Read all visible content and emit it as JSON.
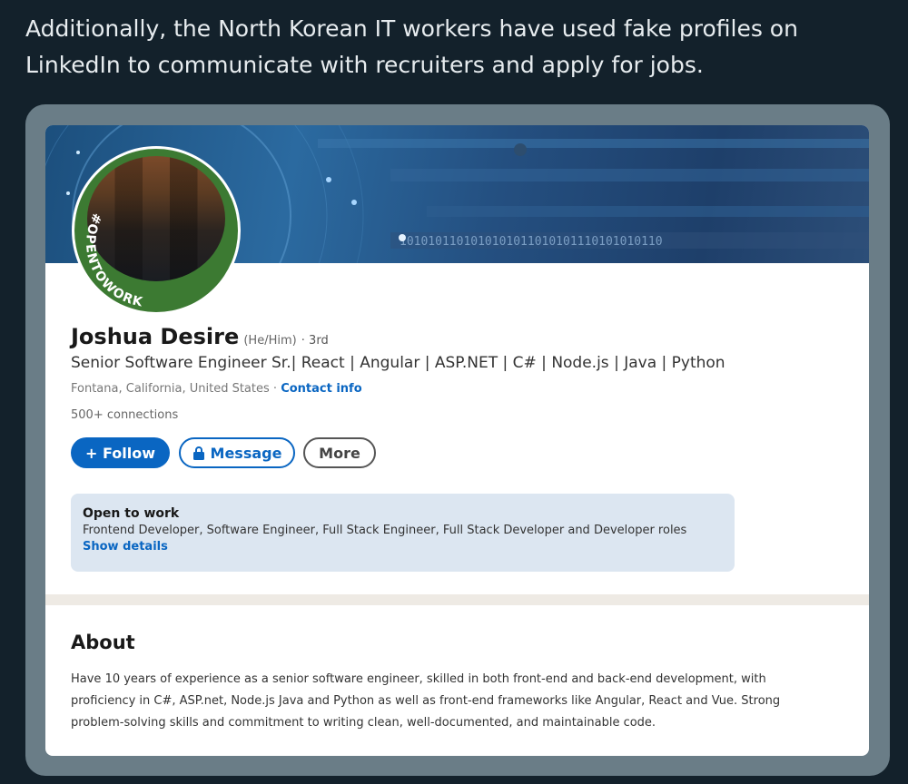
{
  "tweet": {
    "text": "Additionally, the North Korean IT workers have used fake profiles on LinkedIn to communicate with recruiters and apply for jobs."
  },
  "profile": {
    "banner_binary": "1010101101010101011010101110101010110",
    "avatar_ring_text": "#OPENTOWORK",
    "name": "Joshua Desire",
    "pronouns": "(He/Him)",
    "degree": "· 3rd",
    "headline": "Senior Software Engineer Sr.| React | Angular | ASP.NET | C# | Node.js | Java | Python",
    "location": "Fontana, California, United States",
    "location_separator": "·",
    "contact_info": "Contact info",
    "connections": "500+ connections",
    "buttons": {
      "follow": "+ Follow",
      "message": "Message",
      "more": "More"
    },
    "open_to_work": {
      "title": "Open to work",
      "roles": "Frontend Developer, Software Engineer, Full Stack Engineer, Full Stack Developer and Developer roles",
      "link": "Show details"
    },
    "about": {
      "title": "About",
      "text": "Have 10 years of experience as a senior software engineer, skilled in both front-end and back-end development, with proficiency in C#, ASP.net, Node.js Java and Python as well as front-end frameworks like Angular, React and Vue. Strong problem-solving skills and commitment to writing clean, well-documented, and maintainable code."
    }
  },
  "colors": {
    "page_bg": "#13212b",
    "accent_blue": "#0a66c2",
    "open_to_work_green": "#3c7a32",
    "open_to_work_panel": "#dce6f1"
  },
  "icons": {
    "message_button_icon": "lock-icon"
  }
}
